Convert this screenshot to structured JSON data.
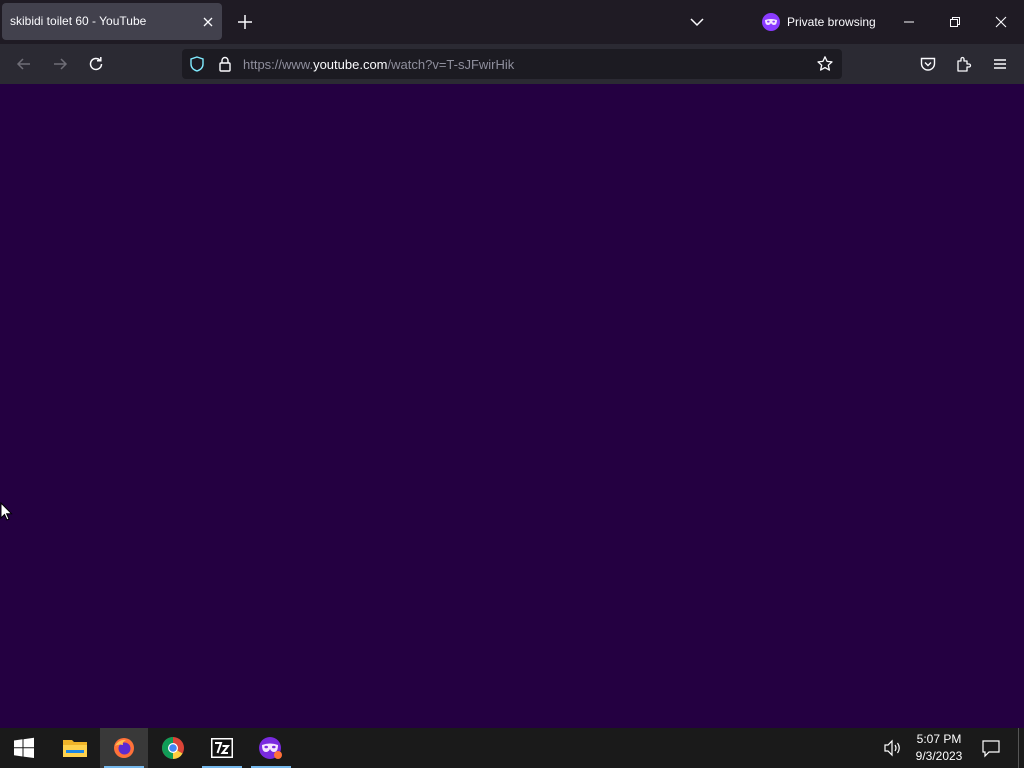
{
  "browser": {
    "tab": {
      "title": "skibidi toilet 60 - YouTube"
    },
    "private_label": "Private browsing",
    "url": {
      "prefix": "https://www.",
      "domain": "youtube.com",
      "path": "/watch?v=T-sJFwirHik"
    }
  },
  "content": {
    "background": "#240041"
  },
  "taskbar": {
    "apps": [
      "start",
      "file-explorer",
      "firefox",
      "chrome",
      "7-zip",
      "firefox-private"
    ],
    "clock": {
      "time": "5:07 PM",
      "date": "9/3/2023"
    }
  },
  "colors": {
    "tabstrip": "#1f1b24",
    "active_tab": "#42414d",
    "navbar": "#2b2a33",
    "urlbar": "#1c1b22",
    "private_accent": "#8a3bff",
    "taskbar": "#1a1a1a"
  }
}
